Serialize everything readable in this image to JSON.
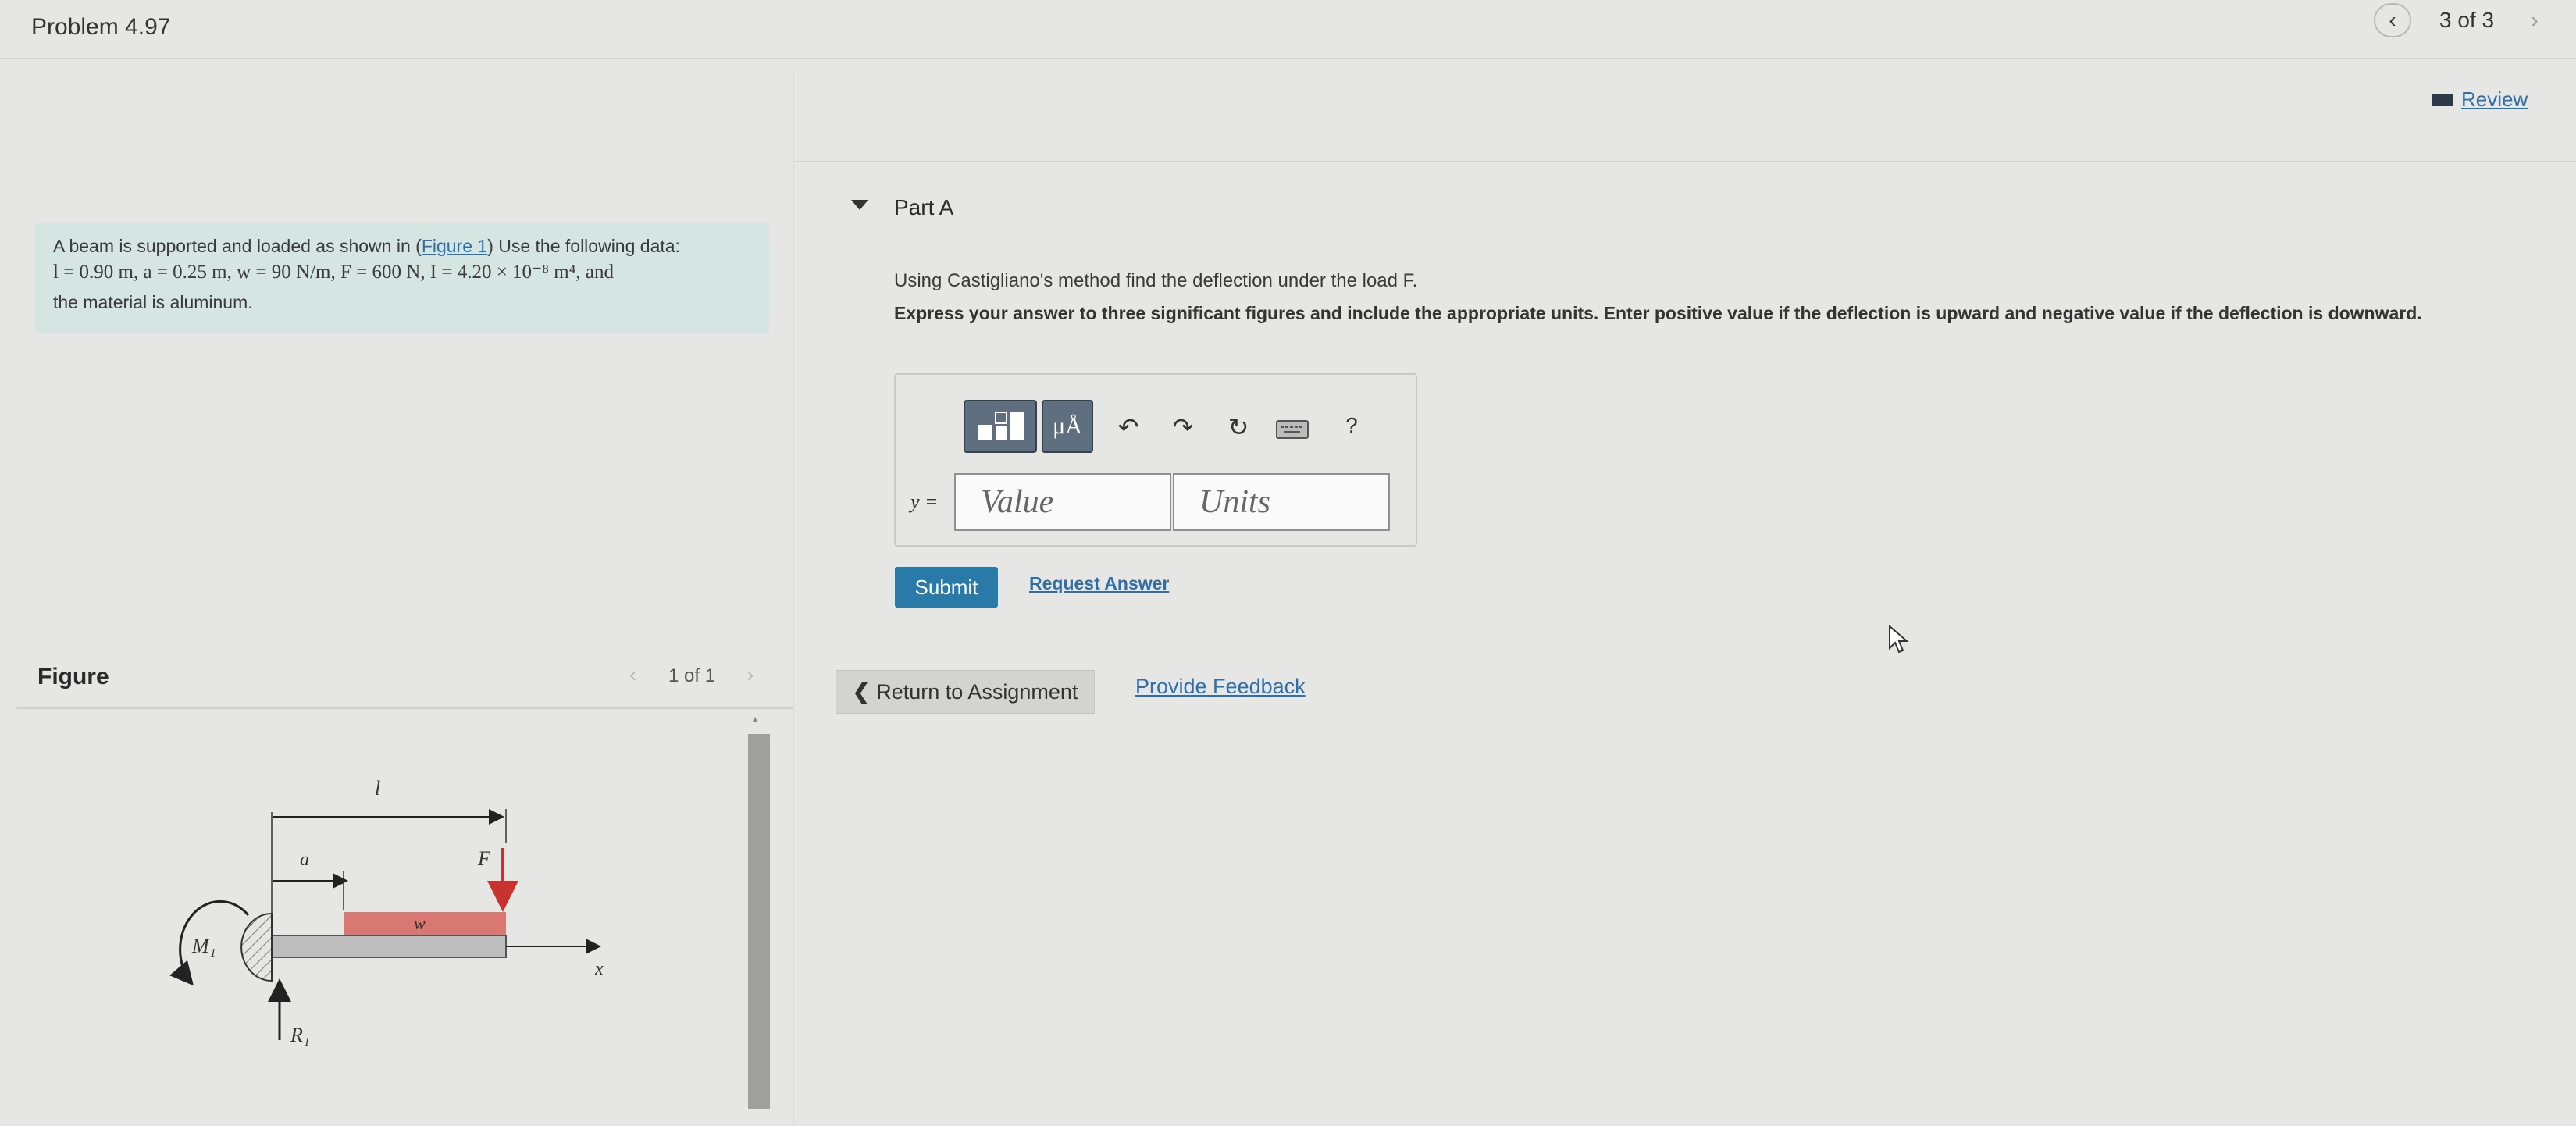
{
  "header": {
    "problem_title": "Problem 4.97",
    "pager_text": "3 of 3"
  },
  "review": {
    "label": "Review"
  },
  "problem": {
    "intro_before_link": "A beam is supported and loaded as shown in (",
    "figure_link": "Figure 1",
    "intro_after_link": ") Use the following data:",
    "data_line": "l = 0.90 m, a = 0.25 m, w = 90 N/m, F = 600 N, I = 4.20 × 10⁻⁸ m⁴, and",
    "material_line": "the material is aluminum."
  },
  "figure": {
    "label": "Figure",
    "counter": "1 of 1",
    "labels": {
      "l": "l",
      "a": "a",
      "F": "F",
      "w": "w",
      "x": "x",
      "M1": "M₁",
      "R1": "R₁"
    }
  },
  "partA": {
    "title": "Part A",
    "question": "Using Castigliano's method find the deflection under the load F.",
    "instructions": "Express your answer to three significant figures and include the appropriate units. Enter positive value if the deflection is upward and negative value if the deflection is downward.",
    "toolbar": {
      "units_label": "μÅ",
      "help_label": "?"
    },
    "answer": {
      "y_label": "y =",
      "value_placeholder": "Value",
      "units_placeholder": "Units"
    },
    "submit_label": "Submit",
    "request_answer_label": "Request Answer"
  },
  "footer": {
    "return_label": "Return to Assignment",
    "feedback_label": "Provide Feedback"
  },
  "colors": {
    "problem_box_bg": "#d4e5e2",
    "link": "#2f6fa8",
    "submit_bg": "#2a7aa7",
    "load_bar": "#d97773",
    "force_arrow": "#c8332f"
  }
}
